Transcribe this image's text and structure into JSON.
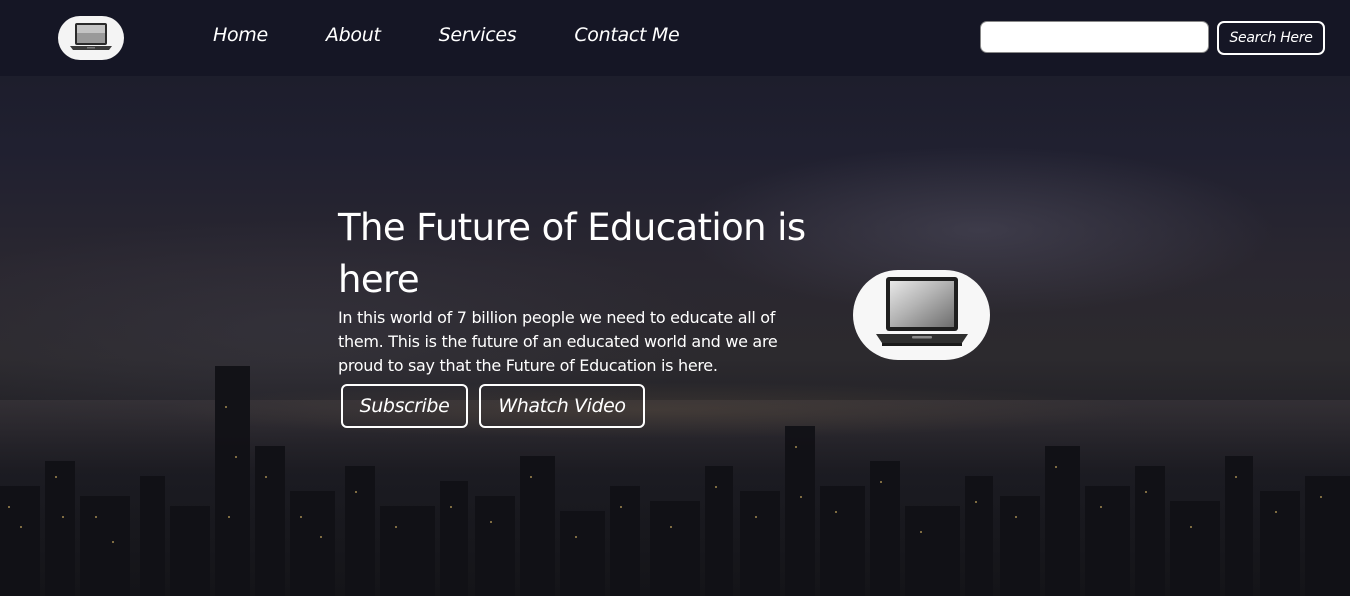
{
  "navbar": {
    "logo_icon": "laptop-icon",
    "links": [
      "Home",
      "About",
      "Services",
      "Contact Me"
    ],
    "search": {
      "value": "",
      "placeholder": "",
      "button_label": "Search Here"
    }
  },
  "hero": {
    "title": "The Future of Education is here",
    "text": "In this world of 7 billion people we need to educate all of them. This is the future of an educated world and we are proud to say that the Future of Education is here.",
    "buttons": {
      "subscribe": "Subscribe",
      "watch_video": "Whatch Video"
    },
    "image_icon": "laptop-icon"
  },
  "colors": {
    "text": "#ffffff",
    "navbar_bg": "#141624",
    "background": "#1c1c26"
  }
}
